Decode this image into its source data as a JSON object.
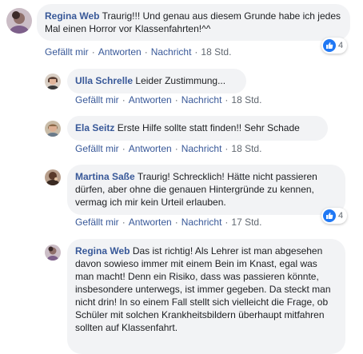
{
  "actions": {
    "like": "Gefällt mir",
    "reply": "Antworten",
    "message": "Nachricht",
    "separator": "·"
  },
  "comments": [
    {
      "author": "Regina Web",
      "text": "Traurig!!! Und genau aus diesem Grunde habe ich jedes Mal einen Horror vor Klassenfahrten!^^",
      "time": "18 Std.",
      "reaction_icon": "like-icon",
      "reaction_count": "4",
      "avatar_color": "#b9a7b3"
    },
    {
      "author": "Ulla Schrelle",
      "text": "Leider Zustimmung...",
      "time": "18 Std.",
      "avatar_color": "#6b5a4e"
    },
    {
      "author": "Ela Seitz",
      "text": "Erste Hilfe sollte statt finden!! Sehr Schade",
      "time": "18 Std.",
      "avatar_color": "#a78d72"
    },
    {
      "author": "Martina Saße",
      "text": "Traurig! Schrecklich! Hätte nicht passieren dürfen, aber ohne die genauen Hintergründe zu kennen, vermag ich mir kein Urteil erlauben.",
      "time": "17 Std.",
      "reaction_icon": "like-icon",
      "reaction_count": "4",
      "avatar_color": "#5a3a2a"
    },
    {
      "author": "Regina Web",
      "text": "Das ist richtig! Als Lehrer ist man abgesehen davon sowieso immer mit einem Bein im Knast, egal was man macht! Denn ein Risiko, dass was passieren könnte, insbesondere unterwegs, ist immer gegeben. Da steckt man nicht drin! In so einem Fall stellt sich vielleicht die Frage, ob Schüler mit solchen Krankheitsbildern überhaupt mitfahren sollten auf Klassenfahrt.",
      "avatar_color": "#b9a7b3"
    }
  ]
}
